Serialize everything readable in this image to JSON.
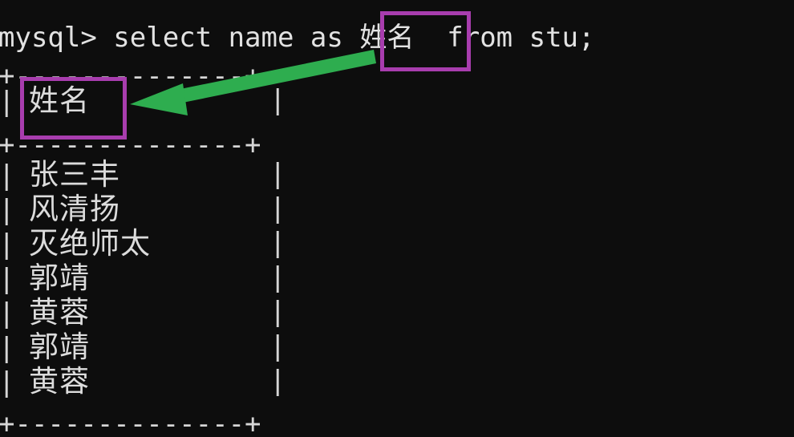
{
  "terminal": {
    "background_color": "#0d0d0d",
    "text_color": "#d8d8d8",
    "prompt": "mysql>",
    "command": "mysql> select name as 姓名  from stu;",
    "command_parts": {
      "prompt": "mysql>",
      "keyword_select": "select",
      "column": "name",
      "keyword_as": "as",
      "alias": "姓名",
      "keyword_from": "from",
      "table": "stu",
      "terminator": ";"
    },
    "table": {
      "border_top": "+--------------+",
      "border_mid": "+--------------+",
      "border_bottom": "+--------------+",
      "vertical_bar": "|",
      "header": "姓名",
      "rows": [
        "张三丰",
        "风清扬",
        "灭绝师太",
        "郭靖",
        "黄蓉",
        "郭靖",
        "黄蓉"
      ]
    }
  },
  "annotations": {
    "highlight_color": "#a83dae",
    "arrow_color": "#2ead4f",
    "boxes": [
      {
        "id": "alias-in-command",
        "label": "姓名"
      },
      {
        "id": "alias-in-result-header",
        "label": "姓名"
      }
    ],
    "arrow": {
      "id": "alias-link-arrow",
      "from": "alias-in-command",
      "to": "alias-in-result-header",
      "direction": "left"
    }
  }
}
